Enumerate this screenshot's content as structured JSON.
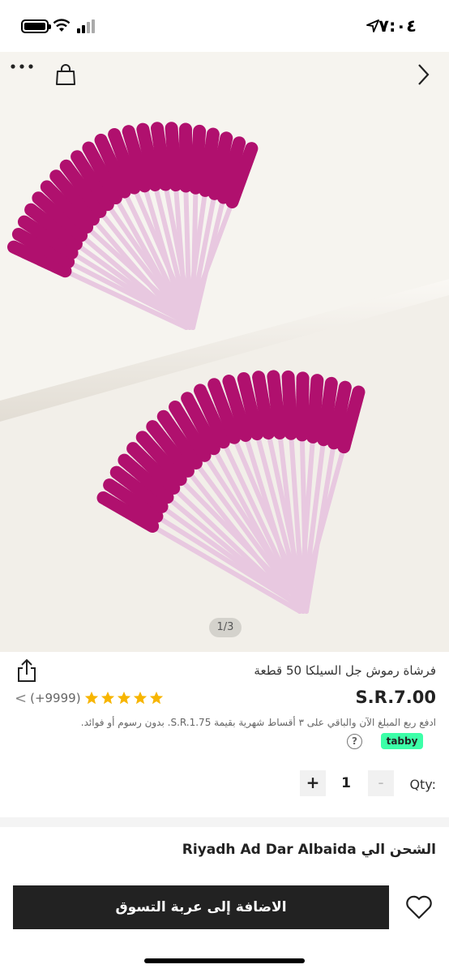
{
  "status_bar": {
    "time": "٧:٠٤",
    "icons": [
      "location-arrow-icon",
      "signal-icon",
      "wifi-icon",
      "battery-icon"
    ]
  },
  "gallery": {
    "counter": "1/3",
    "icons": [
      "more-icon",
      "shopping-bag-icon",
      "chevron-right-icon"
    ]
  },
  "product": {
    "title": "فرشاة رموش جل السيلكا 50 قطعة",
    "price": "S.R.7.00",
    "rating_count": "(+9999)",
    "rating_stars": 5,
    "rating_chevron": "<",
    "star_color": "#f7b500"
  },
  "tabby": {
    "text": "ادفع ربع المبلغ الآن والباقي على ٣ أقساط شهرية بقيمة S.R.1.75. بدون رسوم أو فوائد.",
    "badge": "tabby",
    "help": "?"
  },
  "quantity": {
    "label": "Qty:",
    "value": "1",
    "minus": "-",
    "plus": "+"
  },
  "shipping": {
    "title": "الشحن الي Riyadh Ad Dar Albaida"
  },
  "bottom": {
    "add_to_cart": "الاضافة إلى عربة التسوق"
  },
  "colors": {
    "brush_head": "#b0106e",
    "wand": "#e8c8e0",
    "background": "#f2efe9",
    "button": "#222222",
    "tabby_green": "#3cffa8"
  }
}
